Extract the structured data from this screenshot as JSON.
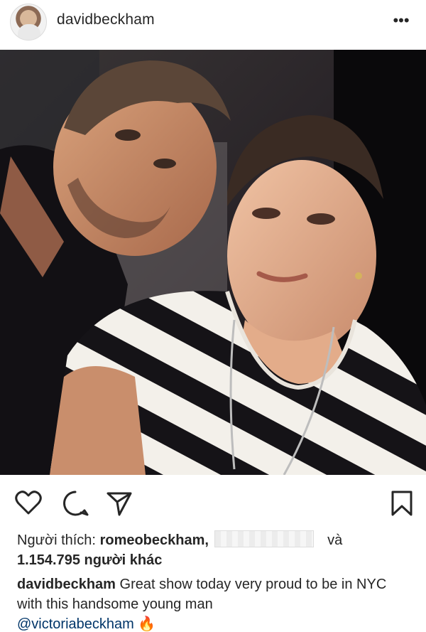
{
  "post": {
    "username": "davidbeckham",
    "more_label": "•••"
  },
  "actions": {
    "like_icon": "heart-icon",
    "comment_icon": "comment-icon",
    "share_icon": "send-icon",
    "save_icon": "bookmark-icon"
  },
  "likes": {
    "prefix": "Người thích:",
    "liker": "romeobeckham,",
    "conjunction": "và",
    "others": "1.154.795 người khác"
  },
  "caption": {
    "username": "davidbeckham",
    "text": "Great show today very proud to be in NYC with this handsome young man",
    "mention": "@victoriabeckham",
    "emoji": "🔥"
  },
  "colors": {
    "text": "#262626",
    "mention": "#003569",
    "border": "#dbdbdb"
  }
}
